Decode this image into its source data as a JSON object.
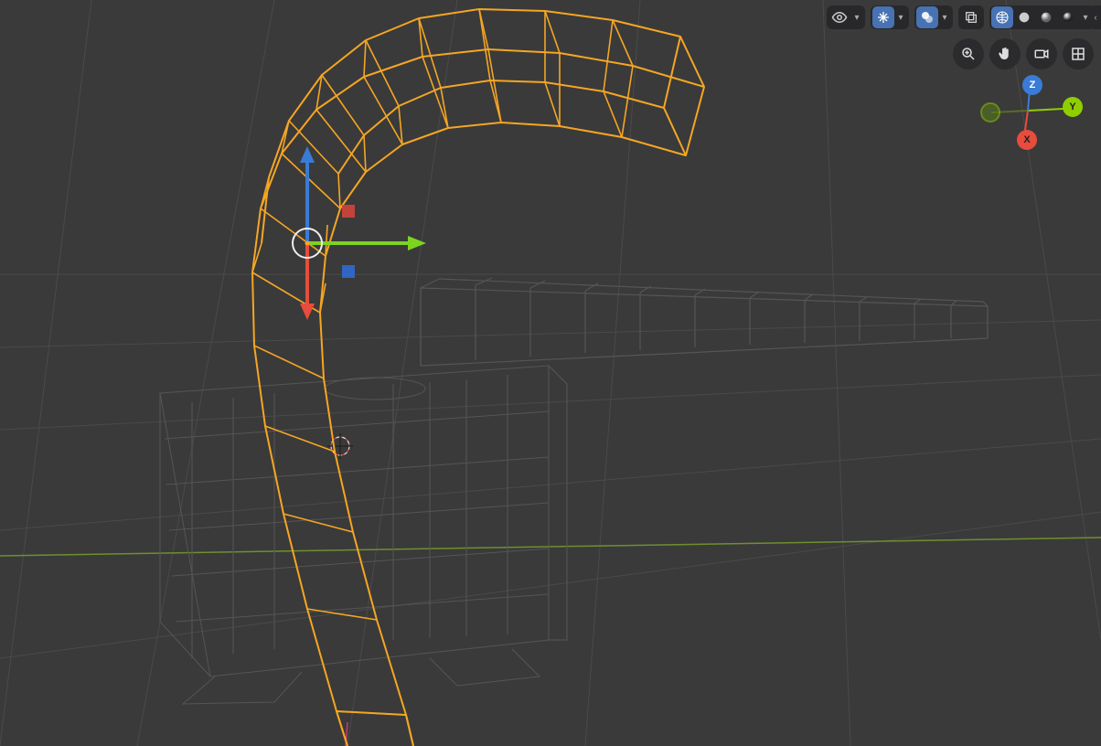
{
  "header": {
    "visibility_tooltip": "Visibility",
    "gizmo_tooltip": "Gizmos",
    "overlays_tooltip": "Overlays",
    "xray_tooltip": "Toggle X-Ray",
    "shading": {
      "wireframe": "Wireframe",
      "solid": "Solid",
      "matprev": "Material Preview",
      "rendered": "Rendered"
    }
  },
  "nav": {
    "axis_x": "X",
    "axis_y": "Y",
    "axis_z": "Z"
  },
  "viewtools": {
    "camera": "Camera View",
    "persp": "Perspective/Ortho",
    "pan": "Pan View",
    "zoom": "Zoom View"
  }
}
